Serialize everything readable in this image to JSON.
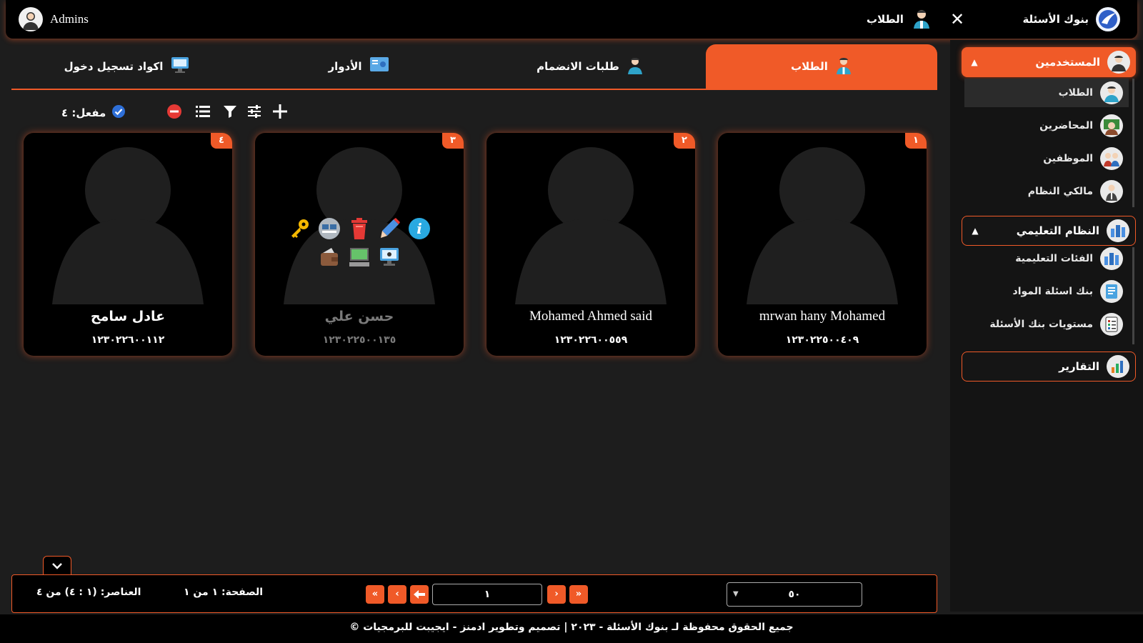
{
  "topbar": {
    "user_name": "Admins",
    "brand_title": "بنوك الأسئلة",
    "current_page": "الطلاب"
  },
  "sidebar": {
    "groups": [
      {
        "label": "المستخدمين",
        "items": [
          "الطلاب",
          "المحاضرين",
          "الموظفين",
          "مالكي النظام"
        ]
      },
      {
        "label": "النظام التعليمي",
        "items": [
          "الفئات التعليمية",
          "بنك اسئلة المواد",
          "مستويات بنك الأسئلة"
        ]
      },
      {
        "label": "التقارير",
        "items": []
      }
    ]
  },
  "tabs": [
    {
      "label": "الطلاب",
      "active": true
    },
    {
      "label": "طلبات الانضمام",
      "active": false
    },
    {
      "label": "الأدوار",
      "active": false
    },
    {
      "label": "اكواد تسجيل دخول",
      "active": false
    }
  ],
  "toolbar": {
    "enabled_label": "مفعل: ٤"
  },
  "cards": [
    {
      "index": "١",
      "name": "mrwan hany Mohamed",
      "code": "١٢٣٠٢٢٥٠٠٤٠٩"
    },
    {
      "index": "٢",
      "name": "Mohamed Ahmed said",
      "code": "١٢٣٠٢٢٦٠٠٥٥٩"
    },
    {
      "index": "٣",
      "name": "حسن علي",
      "code": "١٢٣٠٢٢٥٠٠١٣٥"
    },
    {
      "index": "٤",
      "name": "عادل سامح",
      "code": "١٢٣٠٢٢٦٠٠١١٢"
    }
  ],
  "pager": {
    "items_label": "العناصر: (١ : ٤) من ٤",
    "page_label": "الصفحة: ١ من ١",
    "page_input": "١",
    "page_size": "٥٠"
  },
  "footer": {
    "text": "© جميع الحقوق محفوظة لـ بنوك الأسئلة - ٢٠٢٣ | تصميم وتطوير ادمنز - ايجيبت للبرمجيات"
  },
  "colors": {
    "accent": "#f05a28",
    "background": "#1d1d1d",
    "sidebar": "#141414",
    "card": "#000000"
  }
}
